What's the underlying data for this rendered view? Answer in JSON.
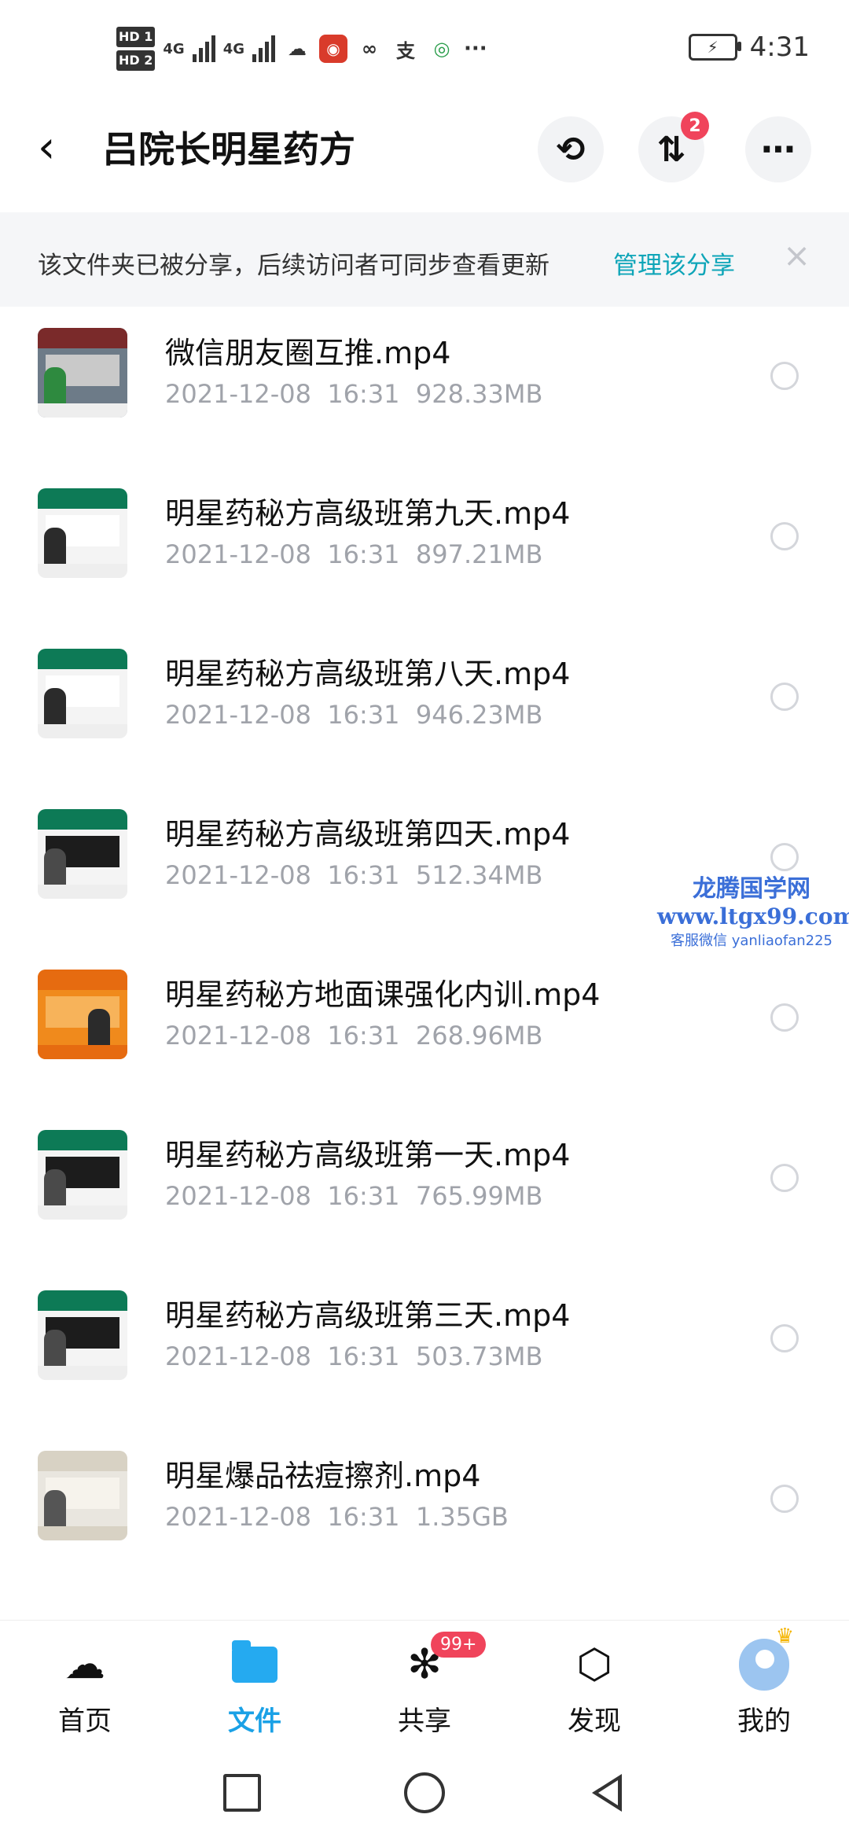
{
  "status_bar": {
    "hd1": "HD 1",
    "hd2": "HD 2",
    "net1": "4G",
    "net2": "4G",
    "more": "···",
    "time": "4:31"
  },
  "header": {
    "back": "‹",
    "title": "吕院长明星药方",
    "transfer_badge": "2"
  },
  "banner": {
    "text": "该文件夹已被分享，后续访问者可同步查看更新",
    "link": "管理该分享",
    "close": "×"
  },
  "files": [
    {
      "name": "微信朋友圈互推.mp4",
      "date": "2021-12-08",
      "time": "16:31",
      "size": "928.33MB"
    },
    {
      "name": "明星药秘方高级班第九天.mp4",
      "date": "2021-12-08",
      "time": "16:31",
      "size": "897.21MB"
    },
    {
      "name": "明星药秘方高级班第八天.mp4",
      "date": "2021-12-08",
      "time": "16:31",
      "size": "946.23MB"
    },
    {
      "name": "明星药秘方高级班第四天.mp4",
      "date": "2021-12-08",
      "time": "16:31",
      "size": "512.34MB"
    },
    {
      "name": "明星药秘方地面课强化内训.mp4",
      "date": "2021-12-08",
      "time": "16:31",
      "size": "268.96MB"
    },
    {
      "name": "明星药秘方高级班第一天.mp4",
      "date": "2021-12-08",
      "time": "16:31",
      "size": "765.99MB"
    },
    {
      "name": "明星药秘方高级班第三天.mp4",
      "date": "2021-12-08",
      "time": "16:31",
      "size": "503.73MB"
    },
    {
      "name": "明星爆品祛痘擦剂.mp4",
      "date": "2021-12-08",
      "time": "16:31",
      "size": "1.35GB"
    }
  ],
  "watermark": {
    "line1": "龙腾国学网",
    "line2": "www.ltgx99.com",
    "line3": "客服微信 yanliaofan225"
  },
  "bottom_nav": [
    {
      "label": "首页",
      "icon": "cloud-icon",
      "active": false
    },
    {
      "label": "文件",
      "icon": "folder-icon",
      "active": true
    },
    {
      "label": "共享",
      "icon": "share-icon",
      "active": false,
      "badge": "99+"
    },
    {
      "label": "发现",
      "icon": "discover-icon",
      "active": false
    },
    {
      "label": "我的",
      "icon": "profile-icon",
      "active": false
    }
  ],
  "colors": {
    "accent": "#1aa1e6",
    "link": "#0ea5b8",
    "badge": "#f0445b",
    "meta_text": "#a0a3aa"
  }
}
